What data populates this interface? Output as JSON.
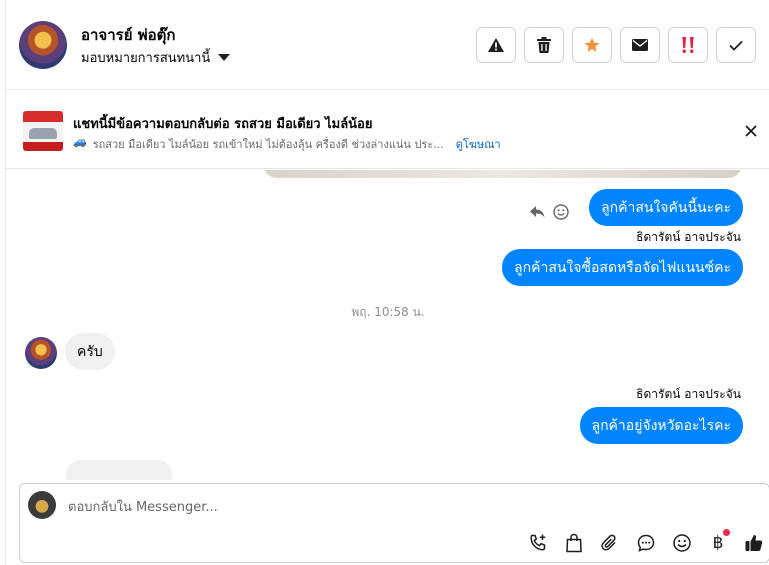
{
  "header": {
    "contact_name": "อาจารย์ พ่อตุ๊ก",
    "assign_label": "มอบหมายการสนทนานี้",
    "actions": [
      {
        "name": "report-spam-button",
        "icon": "warning-icon"
      },
      {
        "name": "delete-button",
        "icon": "trash-icon"
      },
      {
        "name": "star-button",
        "icon": "star-icon"
      },
      {
        "name": "mark-unread-button",
        "icon": "envelope-icon"
      },
      {
        "name": "follow-up-button",
        "icon": "exclamation-icon"
      },
      {
        "name": "mark-done-button",
        "icon": "check-icon"
      }
    ],
    "colors": {
      "star": "#f7923b",
      "follow_up": "#e41e3f"
    }
  },
  "banner": {
    "title": "แชทนี้มีข้อความตอบกลับต่อ รถสวย มือเดียว ไมล์น้อย",
    "subtitle_icon": "🚙",
    "subtitle": "รถสวย มือเดียว ไมล์น้อย รถเข้าใหม่ ไม่ต้องลุ้น ครื่องดี ช่วงล่างแน่น ประ...",
    "link": "ดูโฆษณา"
  },
  "messages": [
    {
      "direction": "out",
      "text": "ลูกค้าสนใจคันนี้นะคะ"
    },
    {
      "direction": "out",
      "sender": "ธิดารัตน์ อาจประจัน",
      "text": "ลูกค้าสนใจซื้อสดหรือจัดไฟแนนซ์คะ"
    },
    {
      "type": "timestamp",
      "text": "พฤ. 10:58 น."
    },
    {
      "direction": "in",
      "text": "ครับ"
    },
    {
      "direction": "out",
      "sender": "ธิดารัตน์ อาจประจัน",
      "text": "ลูกค้าอยู่จังหวัดอะไรคะ"
    }
  ],
  "composer": {
    "placeholder": "ตอบกลับใน Messenger...",
    "tools": [
      "phone-add-icon",
      "bag-icon",
      "paperclip-icon",
      "chat-bubble-icon",
      "emoji-icon",
      "baht-icon",
      "thumbs-up-icon"
    ],
    "baht_symbol": "฿"
  },
  "colors": {
    "outgoing_bubble": "#0084ff",
    "incoming_bubble": "#f0f0f0",
    "link": "#0a66c2"
  }
}
